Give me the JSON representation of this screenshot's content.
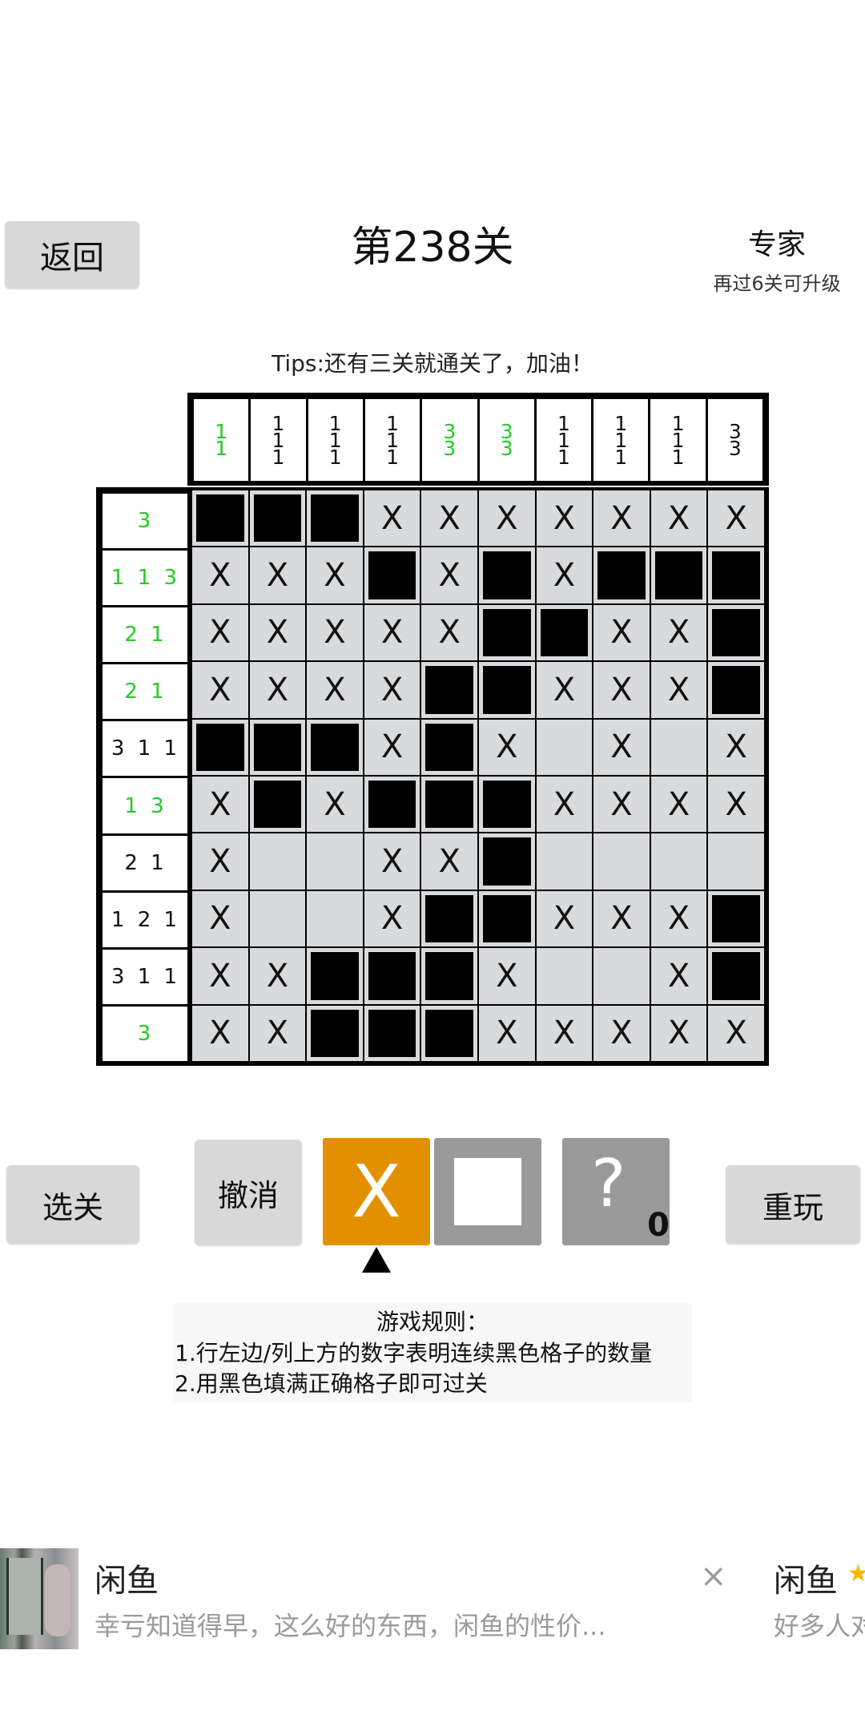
{
  "header": {
    "back_label": "返回",
    "level_title": "第238关",
    "rank": "专家",
    "rank_sub": "再过6关可升级"
  },
  "tips": "Tips:还有三关就通关了，加油！",
  "puzzle": {
    "col_clues": [
      {
        "nums": [
          "1",
          "1"
        ],
        "solved": true
      },
      {
        "nums": [
          "1",
          "1",
          "1"
        ],
        "solved": false
      },
      {
        "nums": [
          "1",
          "1",
          "1"
        ],
        "solved": false
      },
      {
        "nums": [
          "1",
          "1",
          "1"
        ],
        "solved": false
      },
      {
        "nums": [
          "3",
          "3"
        ],
        "solved": true
      },
      {
        "nums": [
          "3",
          "3"
        ],
        "solved": true
      },
      {
        "nums": [
          "1",
          "1",
          "1"
        ],
        "solved": false
      },
      {
        "nums": [
          "1",
          "1",
          "1"
        ],
        "solved": false
      },
      {
        "nums": [
          "1",
          "1",
          "1"
        ],
        "solved": false
      },
      {
        "nums": [
          "3",
          "3"
        ],
        "solved": false
      }
    ],
    "row_clues": [
      {
        "text": "3",
        "solved": true
      },
      {
        "text": "1 1 3",
        "solved": true
      },
      {
        "text": "2 1",
        "solved": true
      },
      {
        "text": "2 1",
        "solved": true
      },
      {
        "text": "3 1 1",
        "solved": false
      },
      {
        "text": "1 3",
        "solved": true
      },
      {
        "text": "2 1",
        "solved": false
      },
      {
        "text": "1 2 1",
        "solved": false
      },
      {
        "text": "3 1 1",
        "solved": false
      },
      {
        "text": "3",
        "solved": true
      }
    ],
    "grid": [
      "###XXXXXXX",
      "XXX#X#X###",
      "XXXXX##XX#",
      "XXXX##XXX#",
      "###X#X.X.X",
      "X#X###XXXX",
      "X..XX#....",
      "X..X##XXX#",
      "XX###X..X#",
      "XX###XXXXX"
    ],
    "mark_symbol": "X"
  },
  "controls": {
    "select_label": "选关",
    "undo_label": "撤消",
    "mode_x_label": "X",
    "hint_symbol": "?",
    "hint_count": "0",
    "replay_label": "重玩",
    "colors": {
      "mode_x": "#e29000",
      "mode_fill": "#9a9a9a",
      "solved_clue": "#22cc22"
    }
  },
  "rules": {
    "title": "游戏规则：",
    "line1": "1.行左边/列上方的数字表明连续黑色格子的数量",
    "line2": "2.用黑色填满正确格子即可过关"
  },
  "ad": {
    "title": "闲鱼",
    "text": "幸亏知道得早，这么好的东西，闲鱼的性价...",
    "close_symbol": "×",
    "next_title": "闲鱼",
    "next_text": "好多人对"
  }
}
